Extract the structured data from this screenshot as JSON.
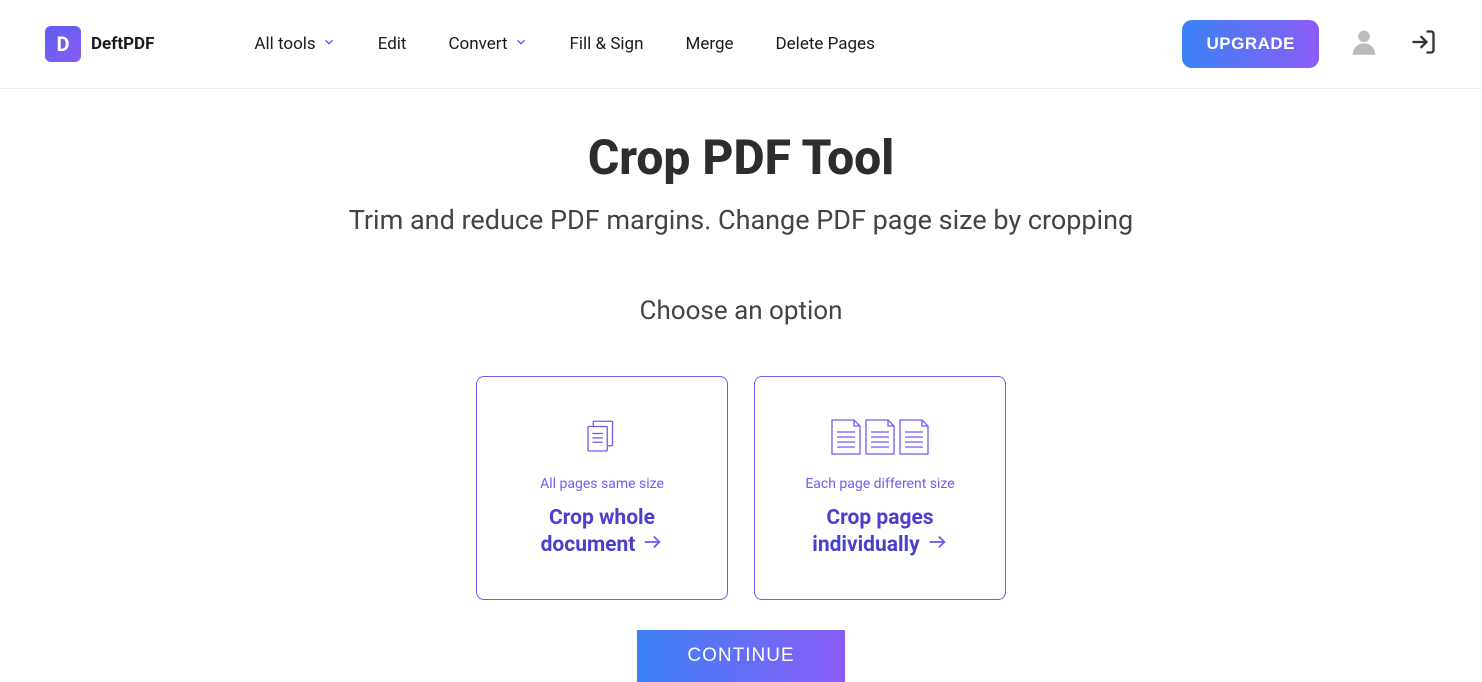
{
  "brand": {
    "logo_letter": "D",
    "name": "DeftPDF"
  },
  "nav": {
    "all_tools": "All tools",
    "edit": "Edit",
    "convert": "Convert",
    "fill_sign": "Fill & Sign",
    "merge": "Merge",
    "delete_pages": "Delete Pages"
  },
  "header": {
    "upgrade": "UPGRADE"
  },
  "page": {
    "title": "Crop PDF Tool",
    "subtitle": "Trim and reduce PDF margins. Change PDF page size by cropping",
    "choose_label": "Choose an option"
  },
  "options": {
    "whole": {
      "sub": "All pages same size",
      "line1": "Crop whole",
      "line2": "document"
    },
    "individual": {
      "sub": "Each page different size",
      "line1": "Crop pages",
      "line2": "individually"
    }
  },
  "actions": {
    "continue": "CONTINUE"
  }
}
